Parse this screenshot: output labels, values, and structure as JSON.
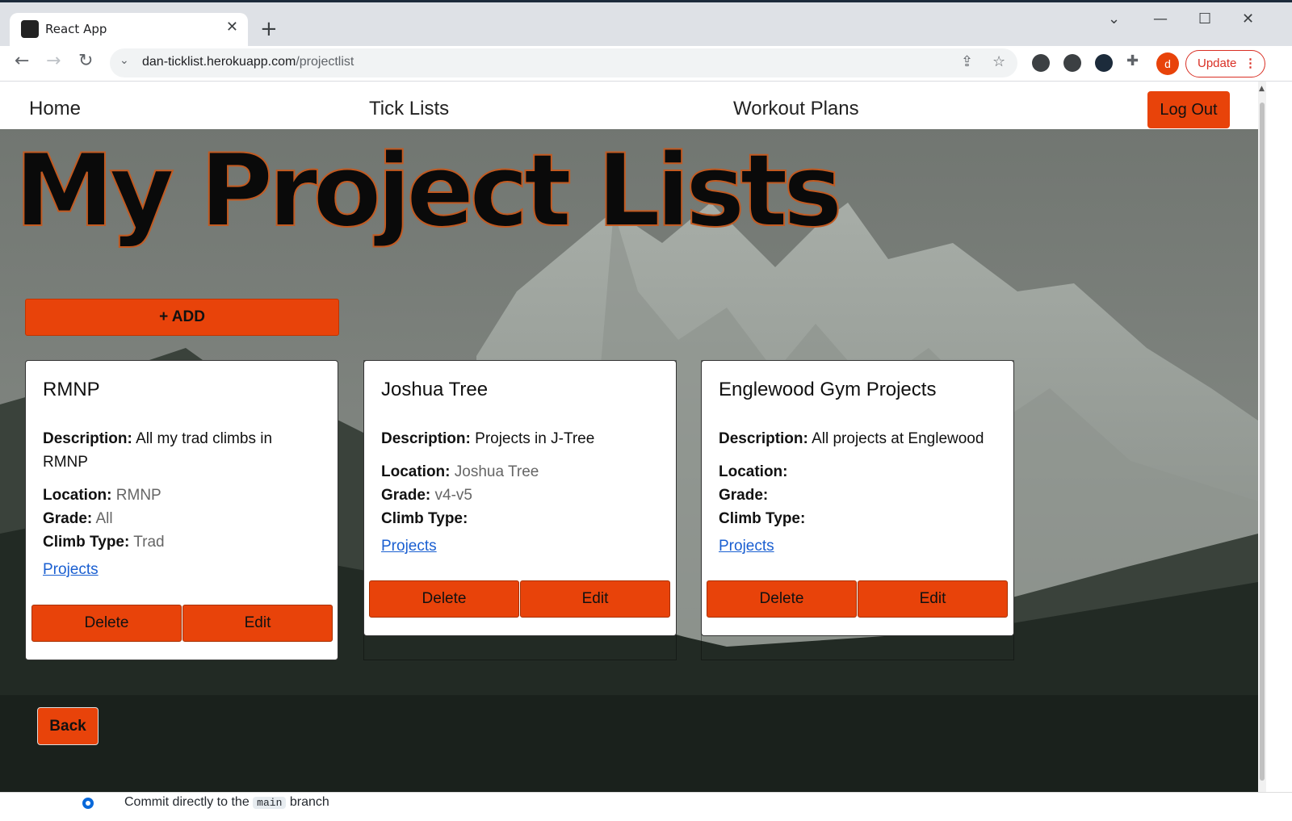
{
  "browser": {
    "tab_title": "React App",
    "tab_close": "✕",
    "new_tab": "+",
    "url_domain": "dan-ticklist.herokuapp.com",
    "url_path": "/projectlist",
    "avatar_letter": "d",
    "update_label": "Update"
  },
  "nav": {
    "home": "Home",
    "tick_lists": "Tick Lists",
    "workout_plans": "Workout Plans",
    "logout": "Log Out"
  },
  "page": {
    "title": "My Project Lists",
    "add_label": "+ ADD",
    "back_label": "Back"
  },
  "labels": {
    "description": "Description:",
    "location": "Location:",
    "grade": "Grade:",
    "climb_type": "Climb Type:",
    "projects_link": "Projects",
    "delete": "Delete",
    "edit": "Edit"
  },
  "cards": [
    {
      "name": "RMNP",
      "description": "All my trad climbs in RMNP",
      "location": "RMNP",
      "grade": "All",
      "climb_type": "Trad"
    },
    {
      "name": "Joshua Tree",
      "description": "Projects in J-Tree",
      "location": "Joshua Tree",
      "grade": "v4-v5",
      "climb_type": ""
    },
    {
      "name": "Englewood Gym Projects",
      "description": "All projects at Englewood",
      "location": "",
      "grade": "",
      "climb_type": ""
    }
  ],
  "underlying_window": {
    "text_before": "Commit directly to the",
    "code": "main",
    "text_after": "branch"
  },
  "colors": {
    "accent": "#e8430a",
    "link": "#1a5fd1"
  }
}
